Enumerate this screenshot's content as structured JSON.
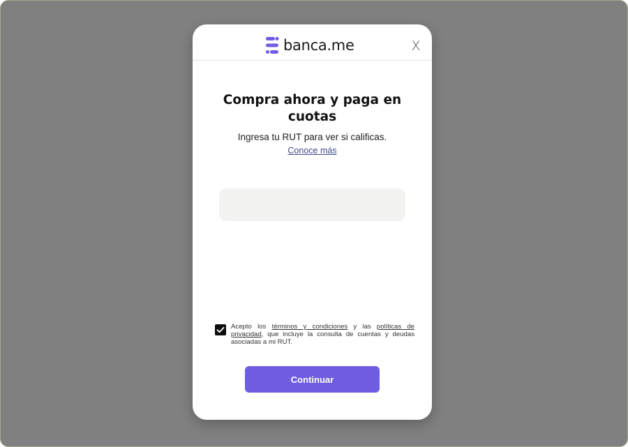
{
  "brand": {
    "name": "banca.me",
    "icon": "banca-me-logo-icon",
    "accent_color": "#6e5de0"
  },
  "modal": {
    "close_label": "X",
    "title": "Compra ahora y paga en cuotas",
    "subtitle": "Ingresa tu RUT para ver si calificas.",
    "learn_more_link": "Conoce más",
    "rut_input": {
      "value": "",
      "placeholder": ""
    },
    "consent": {
      "checked": true,
      "prefix": "Acepto los ",
      "terms_link": "términos y condiciones",
      "middle": " y las ",
      "privacy_link": "políticas de privacidad",
      "suffix": ", que incluye la consulta de cuentas y deudas asociadas a mi RUT."
    },
    "continue_label": "Continuar"
  },
  "colors": {
    "overlay": "#808080",
    "button": "#6e5de0",
    "input_bg": "#f2f2f1",
    "link": "#3c4a8a"
  }
}
